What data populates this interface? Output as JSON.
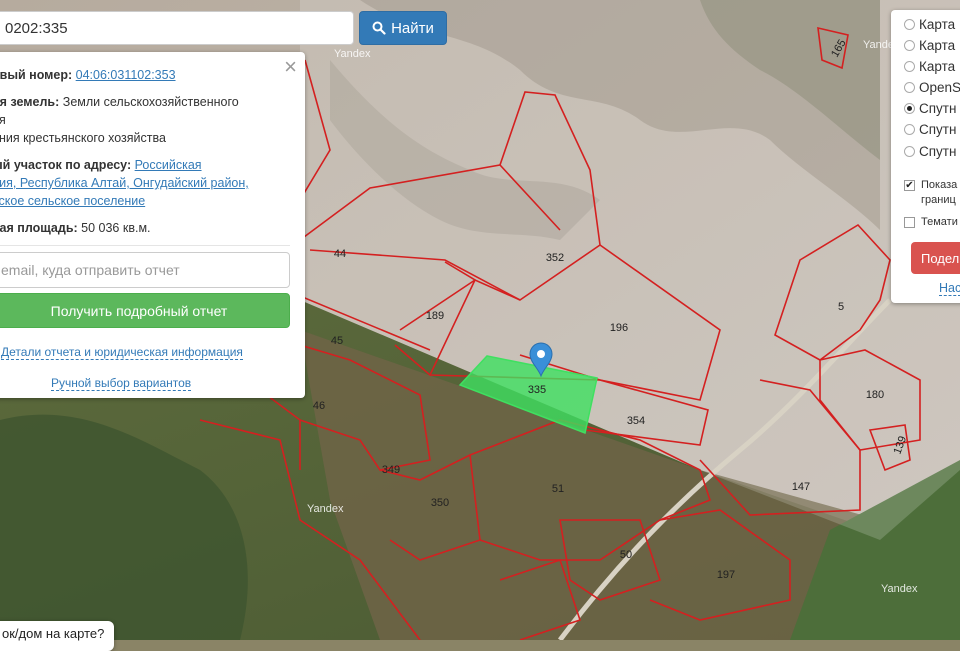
{
  "search": {
    "value": "0202:335",
    "button_label": "Найти"
  },
  "info_panel": {
    "cadastral_label": "овый номер:",
    "cadastral_value": "04:06:031102:353",
    "category_label": "ия земель:",
    "category_value_1": "Земли сельскохозяйственного",
    "category_value_2": "ия",
    "use_line": "ения крестьянского хозяйства",
    "address_label": "ый участок по адресу:",
    "address_line_1": "Российская",
    "address_line_2": "ция, Республика Алтай, Онгудайский район,",
    "address_line_3": "ьское сельское поселение",
    "area_label": "ная площадь:",
    "area_value": "50 036 кв.м.",
    "email_placeholder": "email, куда отправить отчет",
    "report_button": "Получить подробный отчет",
    "details_link": "Детали отчета и юридическая информация",
    "manual_link": "Ручной выбор вариантов"
  },
  "layers": {
    "options": [
      {
        "label": "Карта",
        "selected": false
      },
      {
        "label": "Карта",
        "selected": false
      },
      {
        "label": "Карта",
        "selected": false
      },
      {
        "label": "OpenS",
        "selected": false
      },
      {
        "label": "Спутн",
        "selected": true
      },
      {
        "label": "Спутн",
        "selected": false
      },
      {
        "label": "Спутн",
        "selected": false
      }
    ],
    "show_borders_line_1": "Показа",
    "show_borders_line_2": "границ",
    "show_borders_checked": true,
    "thematic_label": "Темати",
    "thematic_checked": false,
    "share_button": "Подел",
    "settings_link": "Нас"
  },
  "ask_box": "ок/дом на карте?",
  "map": {
    "watermark": "Yandex",
    "parcel_labels": [
      "165",
      "44",
      "352",
      "189",
      "196",
      "5",
      "45",
      "335",
      "354",
      "46",
      "180",
      "139",
      "349",
      "51",
      "147",
      "350",
      "50",
      "197"
    ],
    "selected_parcel": "335",
    "colors": {
      "parcel_border": "#d42020",
      "selected_fill": "#3fe060",
      "search_button": "#337ab7",
      "report_button": "#5cb85c",
      "share_button": "#d9534f"
    }
  }
}
